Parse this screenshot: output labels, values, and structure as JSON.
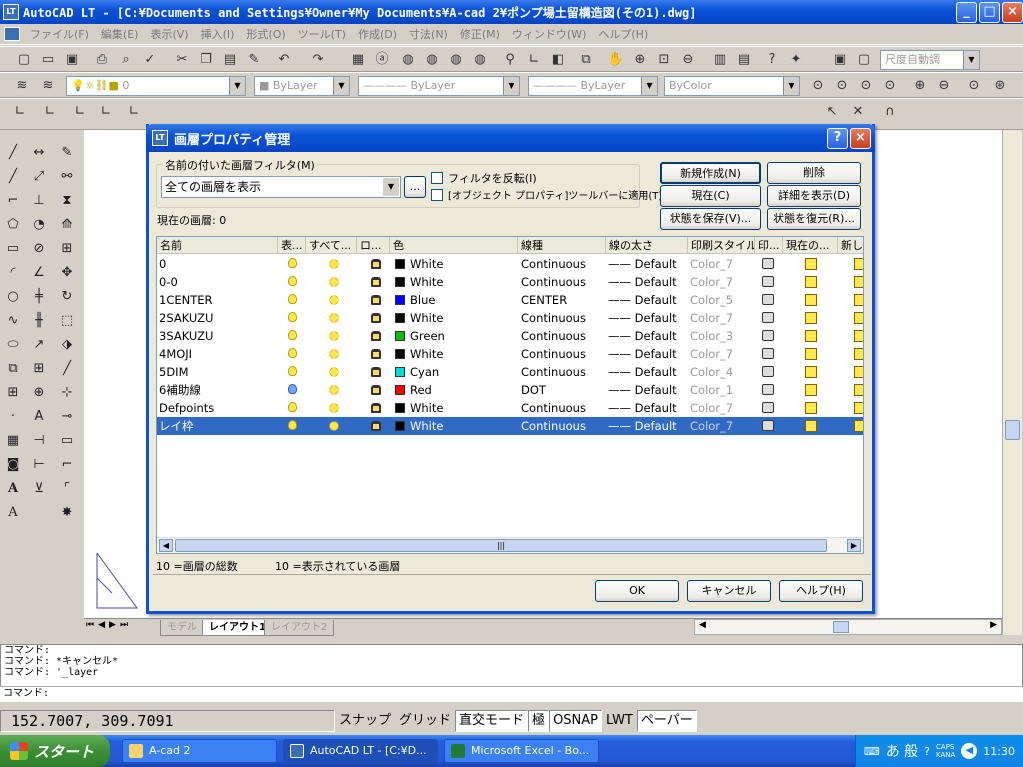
{
  "app": {
    "title": "AutoCAD LT - [C:¥Documents and Settings¥Owner¥My Documents¥A-cad 2¥ポンプ場土留構造図(その1).dwg]",
    "icon_label": "LT"
  },
  "menu": [
    "ファイル(F)",
    "編集(E)",
    "表示(V)",
    "挿入(I)",
    "形式(O)",
    "ツール(T)",
    "作成(D)",
    "寸法(N)",
    "修正(M)",
    "ウィンドウ(W)",
    "ヘルプ(H)"
  ],
  "toolbar": {
    "scale_combo": "尺度自動調",
    "layer_combo": "0",
    "color_combo": "ByLayer",
    "linetype_combo": "ByLayer",
    "lineweight_combo": "ByLayer",
    "plotstyle_combo": "ByColor"
  },
  "layout_tabs": [
    "モデル",
    "レイアウト1",
    "レイアウト2"
  ],
  "command_history": [
    "コマンド:",
    "コマンド: *キャンセル*",
    "コマンド: '_layer"
  ],
  "command_prompt": "コマンド:",
  "status": {
    "coords": "152.7007, 309.7091",
    "buttons": [
      "スナップ",
      "グリッド",
      "直交モード",
      "極",
      "OSNAP",
      "LWT",
      "ペーパー"
    ]
  },
  "taskbar": {
    "start": "スタート",
    "tasks": [
      "A-cad 2",
      "AutoCAD LT - [C:¥D...",
      "Microsoft Excel - Bo..."
    ],
    "tray_ime": "あ 般",
    "tray_caps": "CAPS",
    "tray_kana": "KANA",
    "clock": "11:30"
  },
  "dialog": {
    "title": "画層プロパティ管理",
    "filter_group_label": "名前の付いた画層フィルタ(M)",
    "filter_value": "全ての画層を表示",
    "filter_btn": "...",
    "invert_filter": "フィルタを反転(I)",
    "apply_toolbar": "[オブジェクト プロパティ]ツールバーに適用(T)",
    "current_layer_label": "現在の画層:",
    "current_layer_value": "0",
    "btn_new": "新規作成(N)",
    "btn_delete": "削除",
    "btn_current": "現在(C)",
    "btn_details": "詳細を表示(D)",
    "btn_save_state": "状態を保存(V)...",
    "btn_restore_state": "状態を復元(R)...",
    "columns": [
      "名前",
      "表...",
      "すべて...",
      "ロ...",
      "色",
      "線種",
      "線の太さ",
      "印刷スタイル",
      "印...",
      "現在の...",
      "新し..."
    ],
    "layers": [
      {
        "name": "0",
        "color": "White",
        "hex": "#000000",
        "linetype": "Continuous",
        "lineweight": "—— Default",
        "plot_style": "Color_7",
        "on": true
      },
      {
        "name": "0-0",
        "color": "White",
        "hex": "#000000",
        "linetype": "Continuous",
        "lineweight": "—— Default",
        "plot_style": "Color_7",
        "on": true
      },
      {
        "name": "1CENTER",
        "color": "Blue",
        "hex": "#0000ff",
        "linetype": "CENTER",
        "lineweight": "—— Default",
        "plot_style": "Color_5",
        "on": true
      },
      {
        "name": "2SAKUZU",
        "color": "White",
        "hex": "#000000",
        "linetype": "Continuous",
        "lineweight": "—— Default",
        "plot_style": "Color_7",
        "on": true
      },
      {
        "name": "3SAKUZU",
        "color": "Green",
        "hex": "#00c000",
        "linetype": "Continuous",
        "lineweight": "—— Default",
        "plot_style": "Color_3",
        "on": true
      },
      {
        "name": "4MOJI",
        "color": "White",
        "hex": "#000000",
        "linetype": "Continuous",
        "lineweight": "—— Default",
        "plot_style": "Color_7",
        "on": true
      },
      {
        "name": "5DIM",
        "color": "Cyan",
        "hex": "#00e0e0",
        "linetype": "Continuous",
        "lineweight": "—— Default",
        "plot_style": "Color_4",
        "on": true
      },
      {
        "name": "6補助線",
        "color": "Red",
        "hex": "#ff0000",
        "linetype": "DOT",
        "lineweight": "—— Default",
        "plot_style": "Color_1",
        "on": false
      },
      {
        "name": "Defpoints",
        "color": "White",
        "hex": "#000000",
        "linetype": "Continuous",
        "lineweight": "—— Default",
        "plot_style": "Color_7",
        "on": true
      },
      {
        "name": "レイ枠",
        "color": "White",
        "hex": "#000000",
        "linetype": "Continuous",
        "lineweight": "—— Default",
        "plot_style": "Color_7",
        "on": true
      }
    ],
    "selected_row": 9,
    "total_label": "10 =画層の総数",
    "shown_label": "10 =表示されている画層",
    "btn_ok": "OK",
    "btn_cancel": "キャンセル",
    "btn_help": "ヘルプ(H)"
  }
}
